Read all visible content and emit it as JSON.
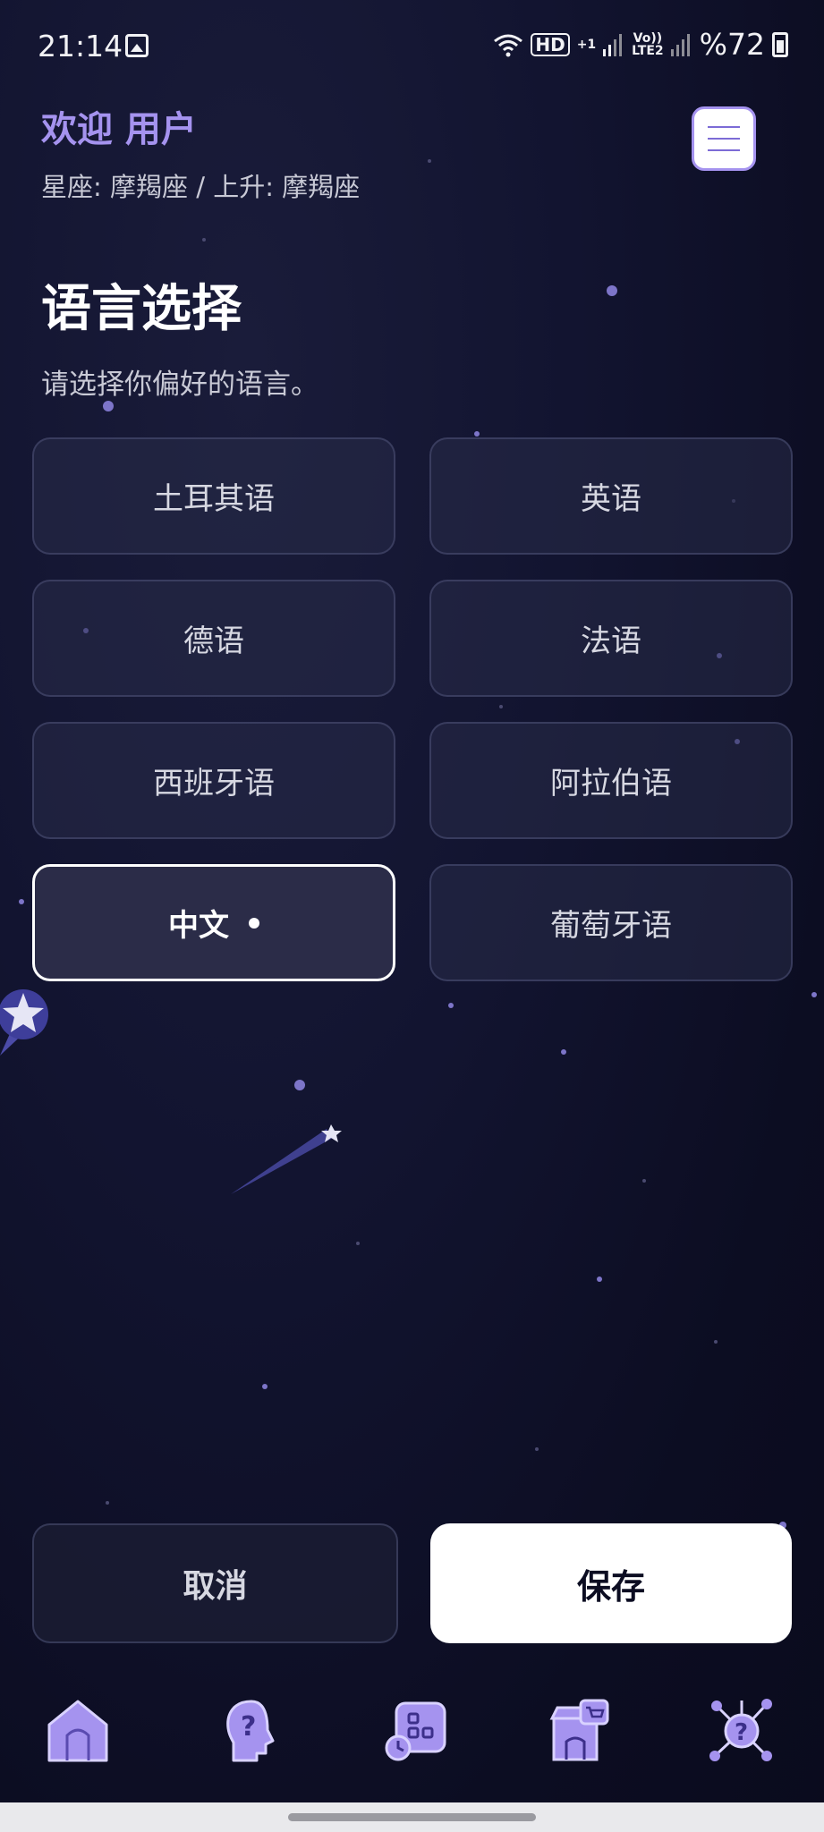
{
  "status_bar": {
    "time": "21:14",
    "hd_label": "HD",
    "plus_label": "+1",
    "volte_top": "Vo))",
    "volte_bottom": "LTE2",
    "battery_text": "%72"
  },
  "header": {
    "welcome": "欢迎 用户",
    "sign_info": "星座: 摩羯座 / 上升: 摩羯座",
    "menu_icon": "hamburger-menu-icon"
  },
  "page": {
    "title": "语言选择",
    "description": "请选择你偏好的语言。"
  },
  "languages": [
    {
      "label": "土耳其语",
      "selected": false
    },
    {
      "label": "英语",
      "selected": false
    },
    {
      "label": "德语",
      "selected": false
    },
    {
      "label": "法语",
      "selected": false
    },
    {
      "label": "西班牙语",
      "selected": false
    },
    {
      "label": "阿拉伯语",
      "selected": false
    },
    {
      "label": "中文",
      "selected": true
    },
    {
      "label": "葡萄牙语",
      "selected": false
    }
  ],
  "actions": {
    "cancel_label": "取消",
    "save_label": "保存"
  },
  "bottom_nav": {
    "items": [
      "home-icon",
      "question-head-icon",
      "grid-clock-icon",
      "store-icon",
      "network-question-icon"
    ]
  },
  "colors": {
    "accent": "#a593ef",
    "accent_dark": "#7c6bd6",
    "background": "#121430",
    "button_bg": "#282b48",
    "white": "#ffffff"
  }
}
